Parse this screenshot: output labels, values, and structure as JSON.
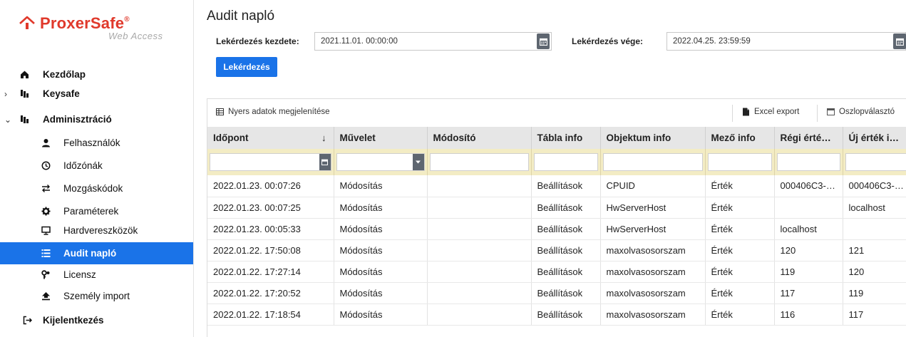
{
  "brand": {
    "name": "ProxerSafe",
    "reg": "®",
    "subtitle": "Web Access",
    "color": "#e0392b"
  },
  "sidebar": {
    "items": [
      {
        "label": "Kezdőlap",
        "icon": "home-icon"
      },
      {
        "label": "Keysafe",
        "icon": "keys-icon",
        "caret": "›"
      },
      {
        "label": "Adminisztráció",
        "icon": "keys-icon",
        "caret": "⌄"
      },
      {
        "label": "Felhasználók",
        "icon": "user-icon"
      },
      {
        "label": "Időzónák",
        "icon": "clock-icon"
      },
      {
        "label": "Mozgáskódok",
        "icon": "exchange-icon"
      },
      {
        "label": "Paraméterek",
        "icon": "gear-icon"
      },
      {
        "label": "Hardvereszközök",
        "icon": "monitor-icon"
      },
      {
        "label": "Audit napló",
        "icon": "list-icon",
        "active": true
      },
      {
        "label": "Licensz",
        "icon": "key-icon"
      },
      {
        "label": "Személy import",
        "icon": "import-icon"
      },
      {
        "label": "Kijelentkezés",
        "icon": "logout-icon"
      }
    ]
  },
  "page": {
    "title": "Audit napló"
  },
  "filters": {
    "start_label": "Lekérdezés kezdete:",
    "start_value": "2021.11.01. 00:00:00",
    "end_label": "Lekérdezés vége:",
    "end_value": "2022.04.25. 23:59:59",
    "query_button": "Lekérdezés"
  },
  "toolbar": {
    "raw_data": "Nyers adatok megjelenítése",
    "excel_export": "Excel export",
    "column_chooser": "Oszlopválasztó"
  },
  "table": {
    "columns": [
      "Időpont",
      "Művelet",
      "Módosító",
      "Tábla info",
      "Objektum info",
      "Mező info",
      "Régi érté…",
      "Új érték i…"
    ],
    "sort_indicator": "↓",
    "rows": [
      [
        "2022.01.23. 00:07:26",
        "Módosítás",
        "",
        "Beállítások",
        "CPUID",
        "Érték",
        "000406C3-…",
        "000406C3-…"
      ],
      [
        "2022.01.23. 00:07:25",
        "Módosítás",
        "",
        "Beállítások",
        "HwServerHost",
        "Érték",
        "",
        "localhost"
      ],
      [
        "2022.01.23. 00:05:33",
        "Módosítás",
        "",
        "Beállítások",
        "HwServerHost",
        "Érték",
        "localhost",
        ""
      ],
      [
        "2022.01.22. 17:50:08",
        "Módosítás",
        "",
        "Beállítások",
        "maxolvasosorszam",
        "Érték",
        "120",
        "121"
      ],
      [
        "2022.01.22. 17:27:14",
        "Módosítás",
        "",
        "Beállítások",
        "maxolvasosorszam",
        "Érték",
        "119",
        "120"
      ],
      [
        "2022.01.22. 17:20:52",
        "Módosítás",
        "",
        "Beállítások",
        "maxolvasosorszam",
        "Érték",
        "117",
        "119"
      ],
      [
        "2022.01.22. 17:18:54",
        "Módosítás",
        "",
        "Beállítások",
        "maxolvasosorszam",
        "Érték",
        "116",
        "117"
      ]
    ]
  },
  "colors": {
    "accent": "#1a73e8",
    "header_bg": "#e6e6e6",
    "filter_row_bg": "#f3ecc4"
  }
}
